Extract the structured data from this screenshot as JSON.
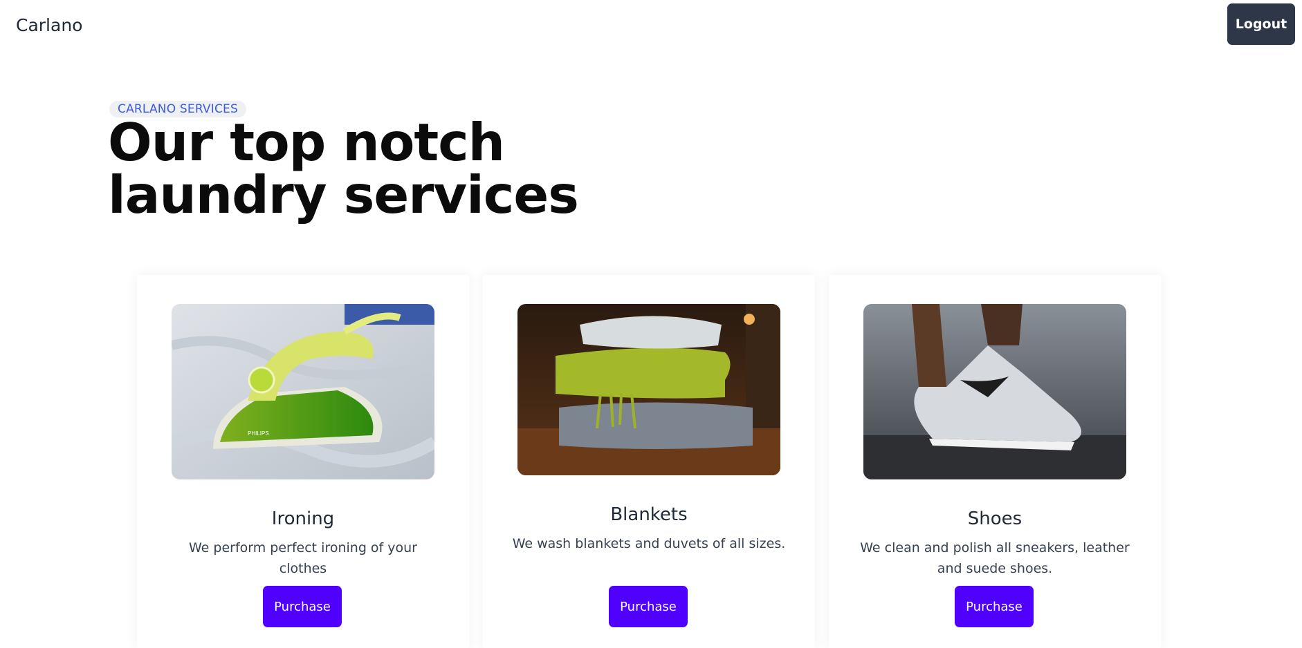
{
  "header": {
    "brand": "Carlano",
    "logout_label": "Logout"
  },
  "hero": {
    "eyebrow": "CARLANO SERVICES",
    "title_line1": "Our top notch",
    "title_line2": "laundry services"
  },
  "services": [
    {
      "title": "Ironing",
      "description": "We perform perfect ironing of your clothes",
      "button_label": "Purchase",
      "image": "iron-photo"
    },
    {
      "title": "Blankets",
      "description": "We wash blankets and duvets of all sizes.",
      "button_label": "Purchase",
      "image": "folded-blankets-photo"
    },
    {
      "title": "Shoes",
      "description": "We clean and polish all sneakers, leather and suede shoes.",
      "button_label": "Purchase",
      "image": "sneaker-photo"
    }
  ],
  "colors": {
    "accent": "#4f00ff",
    "logout_bg": "#2d3748",
    "eyebrow_text": "#3b5bdb"
  }
}
